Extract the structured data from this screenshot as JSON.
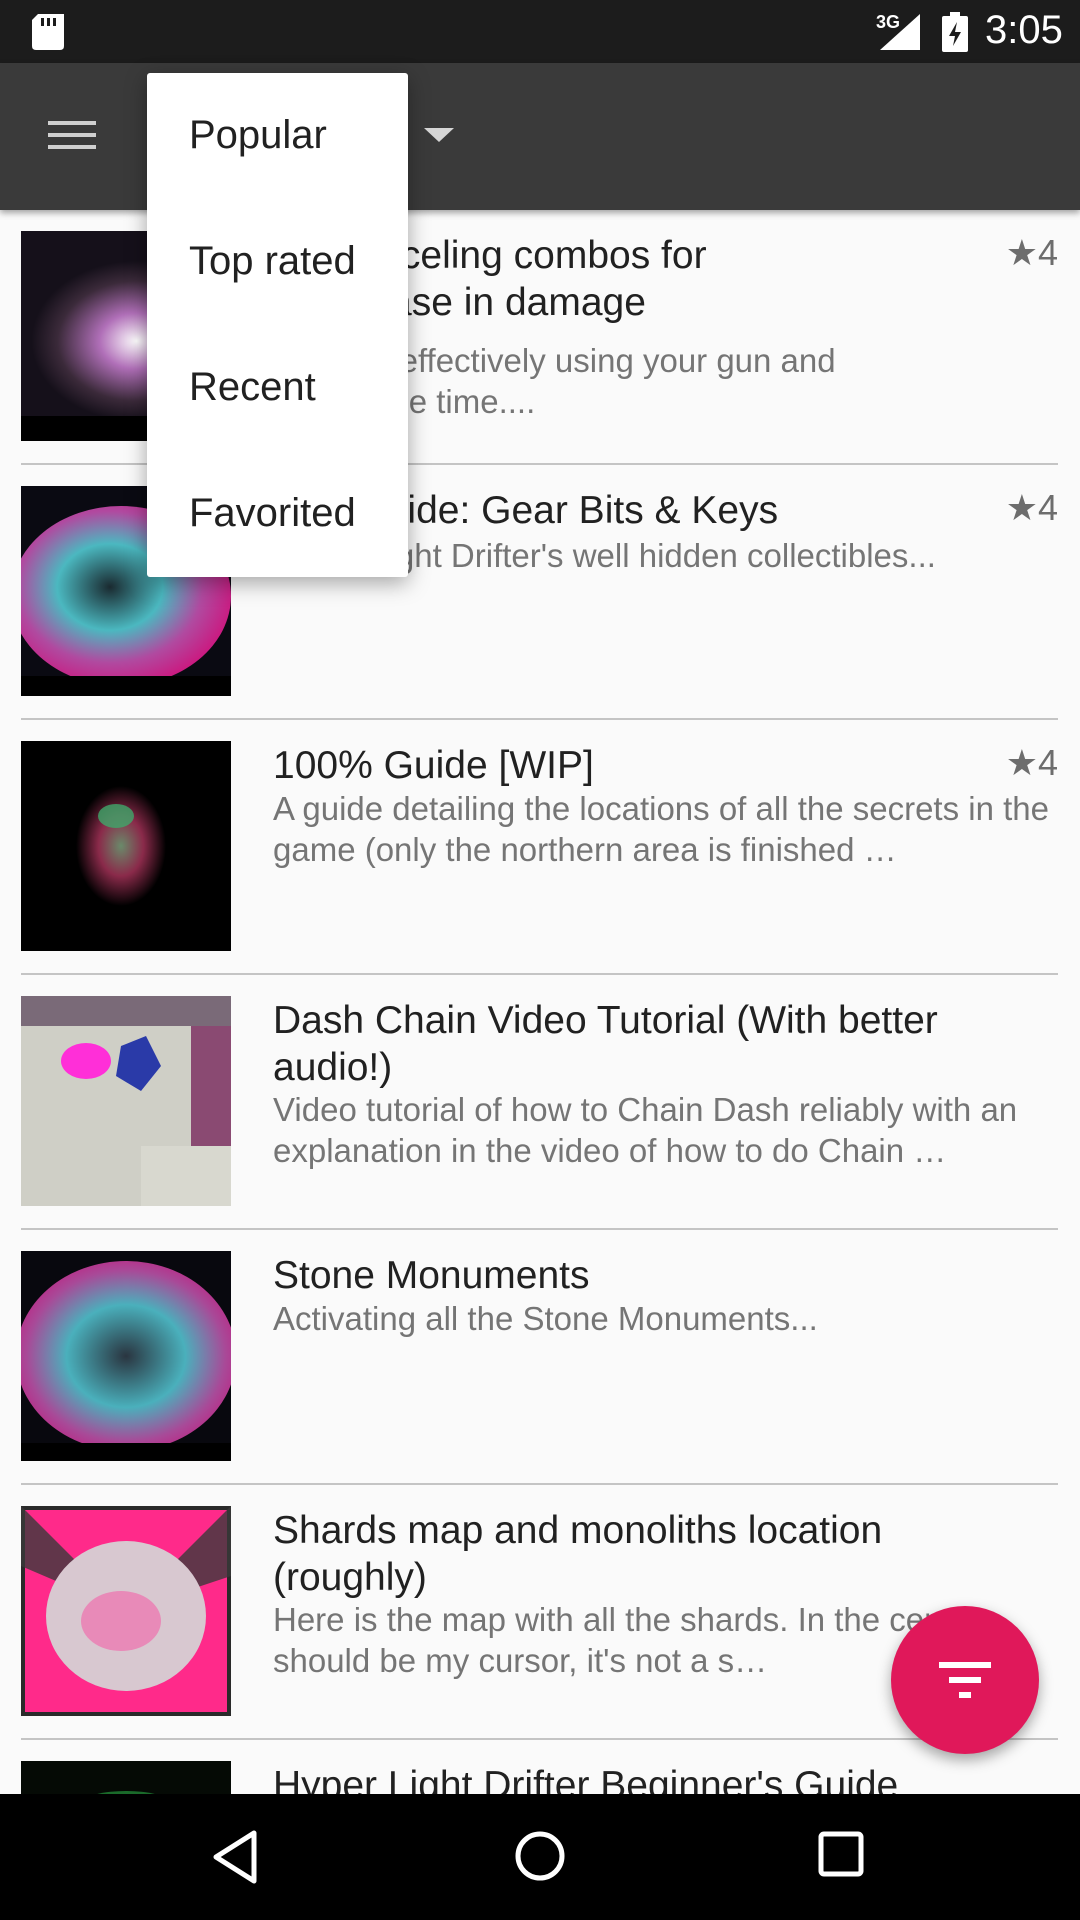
{
  "status_bar": {
    "network": "3G",
    "time": "3:05"
  },
  "sort_menu": {
    "options": [
      "Popular",
      "Top rated",
      "Recent",
      "Favorited"
    ]
  },
  "guides": [
    {
      "title": "ion-canceling combos for\ne increase in damage",
      "description": "guide to effectively using your gun and\nt the same time....",
      "rating": "★4"
    },
    {
      "title": "ibles guide: Gear Bits & Keys",
      "description": "Hyper Light Drifter's well hidden collectibles...",
      "rating": "★4"
    },
    {
      "title": "100% Guide [WIP]",
      "description": "A guide detailing the locations of all the secrets in the game (only the northern area is finished …",
      "rating": "★4"
    },
    {
      "title": "Dash Chain Video Tutorial (With better audio!)",
      "description": "Video tutorial of how to Chain Dash reliably with an explanation in the video of how to do Chain …",
      "rating": ""
    },
    {
      "title": "Stone Monuments",
      "description": "Activating all the Stone Monuments...",
      "rating": ""
    },
    {
      "title": "Shards map and monoliths location (roughly)",
      "description": "Here is the map with all the shards. In the center should be my cursor, it's not a s…",
      "rating": ""
    },
    {
      "title": "Hyper Light Drifter Beginner's Guide",
      "description": "",
      "rating": ""
    }
  ],
  "icons": {
    "menu": "hamburger-menu-icon",
    "fab": "filter-icon",
    "nav": [
      "back-icon",
      "home-icon",
      "recents-icon"
    ]
  },
  "colors": {
    "toolbar": "#3a3a3a",
    "status_bar": "#1c1c1c",
    "fab": "#e0185a",
    "background": "#fafafa"
  }
}
